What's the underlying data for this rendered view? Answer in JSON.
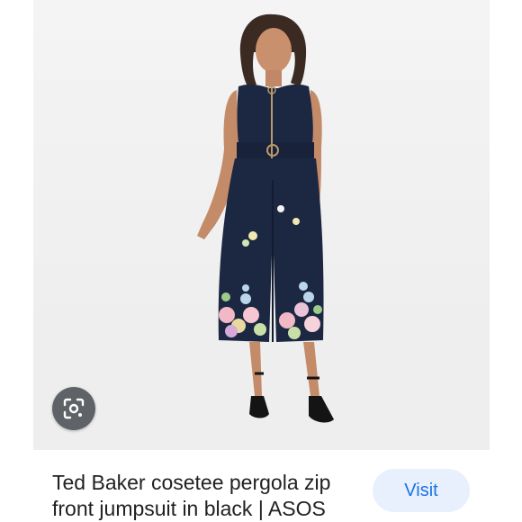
{
  "product": {
    "title": "Ted Baker cosetee pergola zip front jumpsuit in black | ASOS",
    "image_alt": "Model wearing navy sleeveless zip front culotte jumpsuit with floral hem",
    "image_icon": "product-photo-icon"
  },
  "lens": {
    "icon": "lens-search-icon"
  },
  "actions": {
    "visit_label": "Visit"
  },
  "colors": {
    "accent": "#1a73e8",
    "button_bg": "#e8f0fe",
    "lens_bg": "#5f6368",
    "text": "#202124",
    "garment": "#1c2741"
  }
}
